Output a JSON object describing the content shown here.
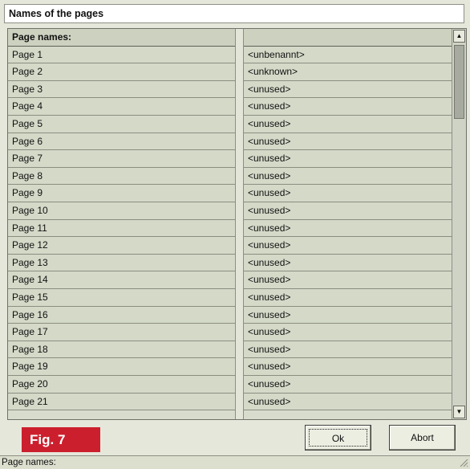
{
  "window": {
    "title": "Names of the pages"
  },
  "table": {
    "header": {
      "left": "Page names:",
      "right": ""
    },
    "rows": [
      {
        "page": "Page 1",
        "name": "<unbenannt>"
      },
      {
        "page": "Page 2",
        "name": "<unknown>"
      },
      {
        "page": "Page 3",
        "name": "<unused>"
      },
      {
        "page": "Page 4",
        "name": "<unused>"
      },
      {
        "page": "Page 5",
        "name": "<unused>"
      },
      {
        "page": "Page 6",
        "name": "<unused>"
      },
      {
        "page": "Page 7",
        "name": "<unused>"
      },
      {
        "page": "Page 8",
        "name": "<unused>"
      },
      {
        "page": "Page 9",
        "name": "<unused>"
      },
      {
        "page": "Page 10",
        "name": "<unused>"
      },
      {
        "page": "Page 11",
        "name": "<unused>"
      },
      {
        "page": "Page 12",
        "name": "<unused>"
      },
      {
        "page": "Page 13",
        "name": "<unused>"
      },
      {
        "page": "Page 14",
        "name": "<unused>"
      },
      {
        "page": "Page 15",
        "name": "<unused>"
      },
      {
        "page": "Page 16",
        "name": "<unused>"
      },
      {
        "page": "Page 17",
        "name": "<unused>"
      },
      {
        "page": "Page 18",
        "name": "<unused>"
      },
      {
        "page": "Page 19",
        "name": "<unused>"
      },
      {
        "page": "Page 20",
        "name": "<unused>"
      },
      {
        "page": "Page 21",
        "name": "<unused>"
      }
    ]
  },
  "buttons": {
    "ok_label": "Ok",
    "abort_label": "Abort"
  },
  "figure_label": "Fig. 7",
  "status_text": "Page names:",
  "icons": {
    "scroll_up": "scroll-up-arrow-icon",
    "scroll_down": "scroll-down-arrow-icon",
    "resize_grip": "resize-grip-icon"
  },
  "colors": {
    "figure_badge": "#cc1f2d",
    "grid_bg": "#d4d9c8"
  }
}
